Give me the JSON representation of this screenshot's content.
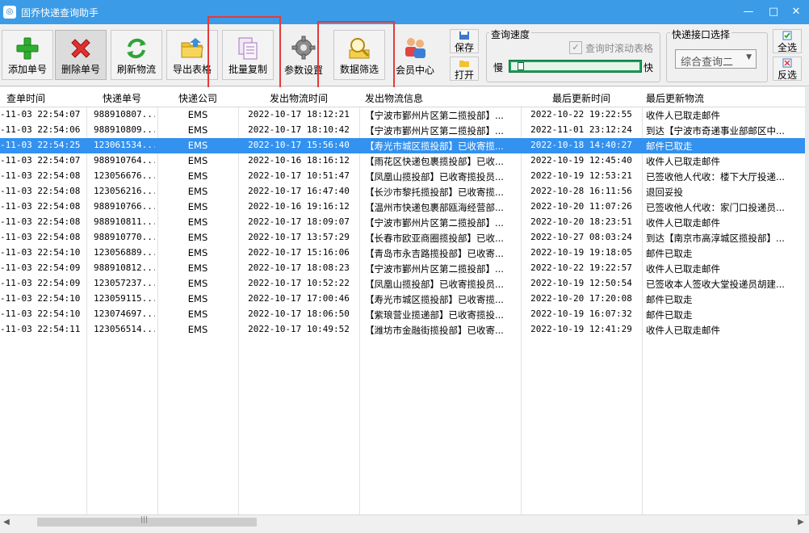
{
  "window": {
    "title": "固乔快递查询助手",
    "minimize": "—",
    "maximize": "□",
    "close": "✕"
  },
  "toolbar": {
    "add_label": "添加单号",
    "delete_label": "删除单号",
    "refresh_label": "刷新物流",
    "export_label": "导出表格",
    "copy_label": "批量复制",
    "settings_label": "参数设置",
    "filter_label": "数据筛选",
    "member_label": "会员中心",
    "save_label": "保存",
    "open_label": "打开",
    "select_all_label": "全选",
    "invert_label": "反选"
  },
  "speed": {
    "group_title": "查询速度",
    "checkbox_label": "查询时滚动表格",
    "checked": true,
    "slow_label": "慢",
    "fast_label": "快",
    "level": 0.02
  },
  "api": {
    "group_title": "快递接口选择",
    "selected": "综合查询二"
  },
  "table": {
    "columns": [
      "查单时间",
      "快递单号",
      "快递公司",
      "发出物流时间",
      "发出物流信息",
      "最后更新时间",
      "最后更新物流"
    ],
    "rows": [
      [
        "-11-03 22:54:07",
        "988910807...",
        "EMS",
        "2022-10-17 18:12:21",
        "【宁波市鄞州片区第二揽投部】...",
        "2022-10-22 19:22:55",
        "收件人已取走邮件"
      ],
      [
        "-11-03 22:54:06",
        "988910809...",
        "EMS",
        "2022-10-17 18:10:42",
        "【宁波市鄞州片区第二揽投部】...",
        "2022-11-01 23:12:24",
        "到达【宁波市奇递事业部邮区中..."
      ],
      [
        "-11-03 22:54:25",
        "123061534...",
        "EMS",
        "2022-10-17 15:56:40",
        "【寿光市城区揽投部】已收寄揽...",
        "2022-10-18 14:40:27",
        "邮件已取走"
      ],
      [
        "-11-03 22:54:07",
        "988910764...",
        "EMS",
        "2022-10-16 18:16:12",
        "【雨花区快递包裹揽投部】已收...",
        "2022-10-19 12:45:40",
        "收件人已取走邮件"
      ],
      [
        "-11-03 22:54:08",
        "123056676...",
        "EMS",
        "2022-10-17 10:51:47",
        "【凤凰山揽投部】已收寄揽投员...",
        "2022-10-19 12:53:21",
        "已签收他人代收：楼下大厅投递..."
      ],
      [
        "-11-03 22:54:08",
        "123056216...",
        "EMS",
        "2022-10-17 16:47:40",
        "【长沙市黎托揽投部】已收寄揽...",
        "2022-10-28 16:11:56",
        "退回妥投"
      ],
      [
        "-11-03 22:54:08",
        "988910766...",
        "EMS",
        "2022-10-16 19:16:12",
        "【温州市快递包裹部瓯海经营部...",
        "2022-10-20 11:07:26",
        "已签收他人代收：家门口投递员..."
      ],
      [
        "-11-03 22:54:08",
        "988910811...",
        "EMS",
        "2022-10-17 18:09:07",
        "【宁波市鄞州片区第二揽投部】...",
        "2022-10-20 18:23:51",
        "收件人已取走邮件"
      ],
      [
        "-11-03 22:54:08",
        "988910770...",
        "EMS",
        "2022-10-17 13:57:29",
        "【长春市欧亚商圈揽投部】已收...",
        "2022-10-27 08:03:24",
        "到达【南京市高淳城区揽投部】..."
      ],
      [
        "-11-03 22:54:10",
        "123056889...",
        "EMS",
        "2022-10-17 15:16:06",
        "【青岛市永吉路揽投部】已收寄...",
        "2022-10-19 19:18:05",
        "邮件已取走"
      ],
      [
        "-11-03 22:54:09",
        "988910812...",
        "EMS",
        "2022-10-17 18:08:23",
        "【宁波市鄞州片区第二揽投部】...",
        "2022-10-22 19:22:57",
        "收件人已取走邮件"
      ],
      [
        "-11-03 22:54:09",
        "123057237...",
        "EMS",
        "2022-10-17 10:52:22",
        "【凤凰山揽投部】已收寄揽投员...",
        "2022-10-19 12:50:54",
        "已签收本人签收大堂投递员胡建..."
      ],
      [
        "-11-03 22:54:10",
        "123059115...",
        "EMS",
        "2022-10-17 17:00:46",
        "【寿光市城区揽投部】已收寄揽...",
        "2022-10-20 17:20:08",
        "邮件已取走"
      ],
      [
        "-11-03 22:54:10",
        "123074697...",
        "EMS",
        "2022-10-17 18:06:50",
        "【紫琅营业揽递部】已收寄揽投...",
        "2022-10-19 16:07:32",
        "邮件已取走"
      ],
      [
        "-11-03 22:54:11",
        "123056514...",
        "EMS",
        "2022-10-17 10:49:52",
        "【潍坊市金融街揽投部】已收寄...",
        "2022-10-19 12:41:29",
        "收件人已取走邮件"
      ]
    ],
    "selected_row": 2
  },
  "scrollbar": {
    "grip": "|||",
    "left_arrow": "◀",
    "right_arrow": "▶"
  },
  "colors": {
    "titlebar": "#3b9be6",
    "selection": "#3391ef",
    "highlight_box": "#e23b3b"
  }
}
